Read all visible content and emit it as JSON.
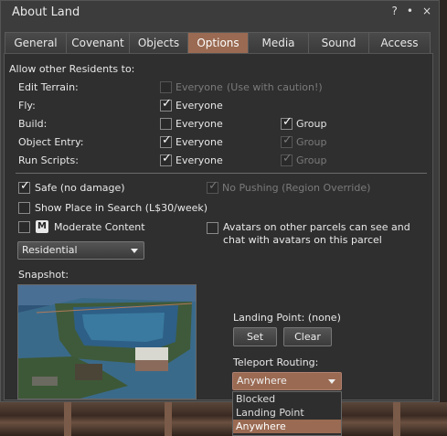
{
  "window": {
    "title": "About Land",
    "help_icon": "?",
    "minimize_icon": "•",
    "close_icon": "×"
  },
  "tabs": [
    {
      "label": "General"
    },
    {
      "label": "Covenant"
    },
    {
      "label": "Objects"
    },
    {
      "label": "Options",
      "active": true
    },
    {
      "label": "Media"
    },
    {
      "label": "Sound"
    },
    {
      "label": "Access"
    }
  ],
  "options": {
    "heading": "Allow other Residents to:",
    "rows": [
      {
        "label": "Edit Terrain:",
        "everyone": "Everyone",
        "note": "(Use with caution!)"
      },
      {
        "label": "Fly:",
        "everyone": "Everyone"
      },
      {
        "label": "Build:",
        "everyone": "Everyone",
        "group": "Group"
      },
      {
        "label": "Object Entry:",
        "everyone": "Everyone",
        "group": "Group"
      },
      {
        "label": "Run Scripts:",
        "everyone": "Everyone",
        "group": "Group"
      }
    ],
    "safe": "Safe (no damage)",
    "no_pushing": "No Pushing (Region Override)",
    "show_in_search": "Show Place in Search (L$30/week)",
    "moderate_badge": "M",
    "moderate": "Moderate Content",
    "avatars_see_line1": "Avatars on other parcels can see and",
    "avatars_see_line2": "chat with avatars on this parcel",
    "category": "Residential",
    "snapshot_label": "Snapshot:",
    "landing_point": "Landing Point: (none)",
    "set_button": "Set",
    "clear_button": "Clear",
    "teleport_routing_label": "Teleport Routing:",
    "teleport_routing_value": "Anywhere",
    "teleport_options": [
      "Blocked",
      "Landing Point",
      "Anywhere"
    ]
  },
  "colors": {
    "accent": "#9a6a52",
    "panel": "#2f2f2f",
    "window": "#3c3c3c"
  }
}
